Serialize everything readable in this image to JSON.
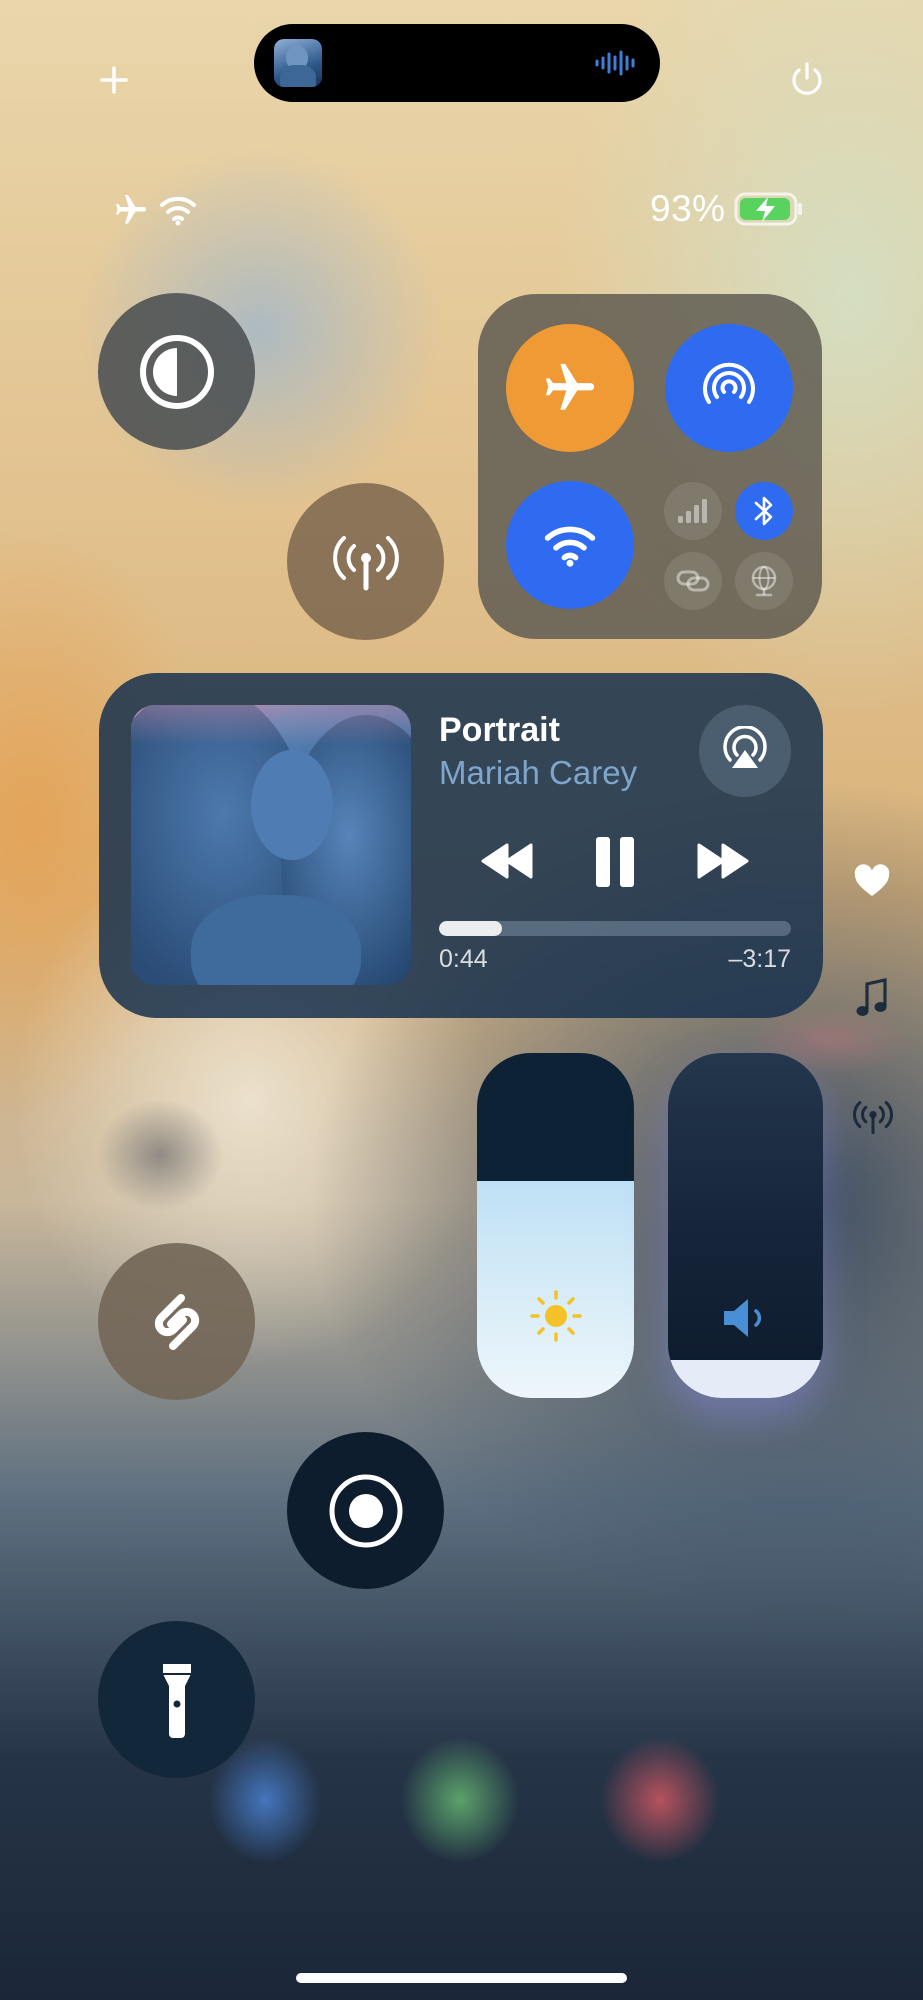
{
  "status_bar": {
    "battery_percent": "93%",
    "icons": [
      "airplane-icon",
      "wifi-icon",
      "battery-charging-icon"
    ]
  },
  "top_bar": {
    "add_icon": "plus-icon",
    "power_icon": "power-icon",
    "dynamic_island": {
      "activity": "now-playing",
      "waveform_icon": "waveform-icon"
    }
  },
  "controls": {
    "dark_mode": {
      "icon": "dark-mode-icon"
    },
    "cellular_hotspot": {
      "icon": "antenna-icon"
    },
    "connectivity": {
      "airplane_mode": {
        "icon": "airplane-icon",
        "state": "on",
        "color": "#f09a35"
      },
      "airdrop": {
        "icon": "airdrop-icon",
        "state": "on",
        "color": "#2f6bf0"
      },
      "wifi": {
        "icon": "wifi-icon",
        "state": "on",
        "color": "#2f6bf0"
      },
      "cellular_data": {
        "icon": "cellular-bars-icon",
        "state": "off"
      },
      "bluetooth": {
        "icon": "bluetooth-icon",
        "state": "on",
        "color": "#2f6bf0"
      },
      "personal_hotspot": {
        "icon": "link-icon",
        "state": "off"
      },
      "vpn": {
        "icon": "globe-icon",
        "state": "off"
      }
    },
    "shazam": {
      "icon": "shazam-icon"
    },
    "screen_recording": {
      "icon": "record-icon"
    },
    "flashlight": {
      "icon": "flashlight-icon"
    }
  },
  "now_playing": {
    "title": "Portrait",
    "artist": "Mariah Carey",
    "elapsed": "0:44",
    "remaining": "–3:17",
    "progress": 0.18,
    "state": "playing",
    "airplay_icon": "airplay-audio-icon"
  },
  "sliders": {
    "brightness": {
      "icon": "sun-icon",
      "level": 0.63
    },
    "volume": {
      "icon": "speaker-icon",
      "level": 0.11
    }
  },
  "page_indicators": [
    "heart-icon",
    "music-note-icon",
    "antenna-icon"
  ]
}
